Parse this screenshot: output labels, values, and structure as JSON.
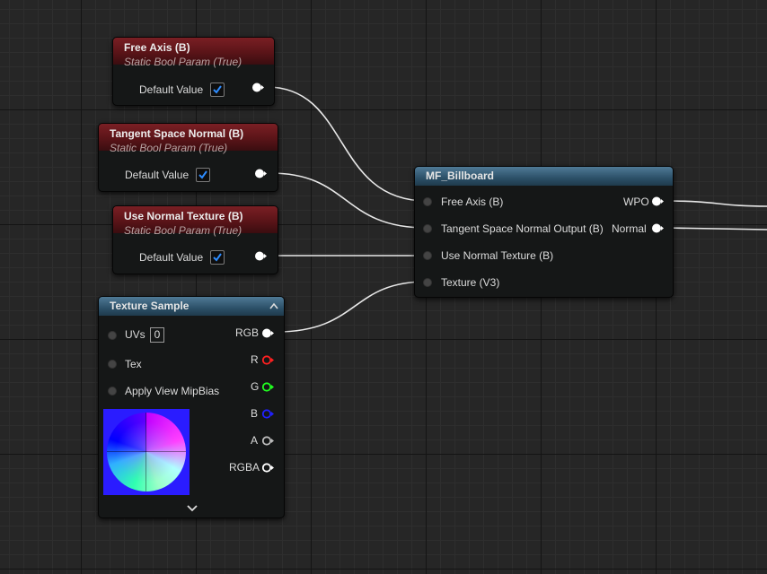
{
  "param_nodes": [
    {
      "title": "Free Axis (B)",
      "subtitle": "Static Bool Param (True)",
      "default_label": "Default Value",
      "checked": true
    },
    {
      "title": "Tangent Space Normal (B)",
      "subtitle": "Static Bool Param (True)",
      "default_label": "Default Value",
      "checked": true
    },
    {
      "title": "Use Normal Texture (B)",
      "subtitle": "Static Bool Param (True)",
      "default_label": "Default Value",
      "checked": true
    }
  ],
  "billboard_node": {
    "title": "MF_Billboard",
    "inputs": [
      "Free Axis (B)",
      "Tangent Space Normal Output (B)",
      "Use Normal Texture (B)",
      "Texture (V3)"
    ],
    "outputs": [
      "WPO",
      "Normal"
    ]
  },
  "texture_node": {
    "title": "Texture Sample",
    "inputs": {
      "uvs": "UVs",
      "uvs_value": "0",
      "tex": "Tex",
      "mipbias": "Apply View MipBias"
    },
    "outputs": [
      "RGB",
      "R",
      "G",
      "B",
      "A",
      "RGBA"
    ],
    "output_colors": [
      "#ffffff",
      "#ff2020",
      "#20ff20",
      "#2020ff",
      "#bbbbbb",
      "#ffffff"
    ]
  }
}
